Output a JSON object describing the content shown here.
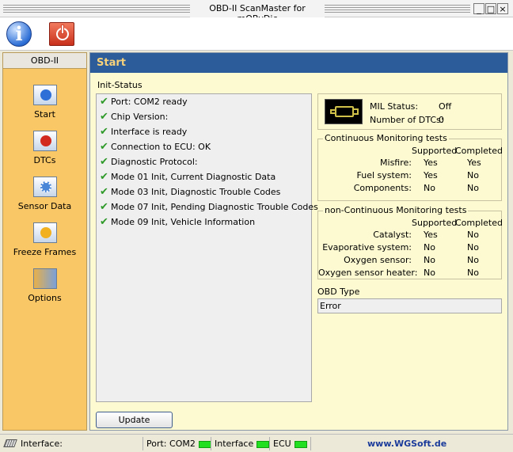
{
  "window": {
    "title": "OBD-II ScanMaster for mOByDic"
  },
  "toolbar": {
    "info_icon": "info-icon",
    "power_icon": "power-icon"
  },
  "sidebar": {
    "header": "OBD-II",
    "items": [
      {
        "label": "Start",
        "icon": "start-icon"
      },
      {
        "label": "DTCs",
        "icon": "dtc-icon"
      },
      {
        "label": "Sensor Data",
        "icon": "sensor-icon"
      },
      {
        "label": "Freeze Frames",
        "icon": "freeze-frames-icon"
      },
      {
        "label": "Options",
        "icon": "options-icon"
      }
    ]
  },
  "main": {
    "title": "Start",
    "init_status_label": "Init-Status",
    "init_status": [
      "Port: COM2 ready",
      "Chip Version:",
      "Interface is ready",
      "Connection to ECU: OK",
      "Diagnostic Protocol:",
      "Mode 01 Init, Current Diagnostic Data",
      "Mode 03 Init, Diagnostic Trouble Codes",
      "Mode 07 Init, Pending Diagnostic Trouble Codes",
      "Mode 09 Init, Vehicle Information"
    ],
    "mil": {
      "status_label": "MIL Status:",
      "status_value": "Off",
      "dtc_label": "Number of DTCs:",
      "dtc_value": "0"
    },
    "continuous": {
      "title": "Continuous Monitoring tests",
      "col_supported": "Supported",
      "col_completed": "Completed",
      "rows": [
        {
          "name": "Misfire:",
          "supported": "Yes",
          "completed": "Yes"
        },
        {
          "name": "Fuel system:",
          "supported": "Yes",
          "completed": "No"
        },
        {
          "name": "Components:",
          "supported": "No",
          "completed": "No"
        }
      ]
    },
    "non_continuous": {
      "title": "non-Continuous Monitoring tests",
      "col_supported": "Supported",
      "col_completed": "Completed",
      "rows": [
        {
          "name": "Catalyst:",
          "supported": "Yes",
          "completed": "No"
        },
        {
          "name": "Evaporative system:",
          "supported": "No",
          "completed": "No"
        },
        {
          "name": "Oxygen sensor:",
          "supported": "No",
          "completed": "No"
        },
        {
          "name": "Oxygen sensor heater:",
          "supported": "No",
          "completed": "No"
        }
      ]
    },
    "obd_type_label": "OBD Type",
    "obd_type_value": "Error",
    "update_label": "Update"
  },
  "statusbar": {
    "interface_label": "Interface:",
    "port_label": "Port: COM2",
    "interface_indicator_label": "Interface",
    "ecu_label": "ECU",
    "link": "www.WGSoft.de"
  },
  "colors": {
    "sidebar_bg": "#fac766",
    "header_bg": "#2c5c9a",
    "header_text": "#f7d27a",
    "main_bg": "#fdfad1",
    "check": "#2f9a2a",
    "led": "#22e01f",
    "link": "#1b3b9b"
  }
}
